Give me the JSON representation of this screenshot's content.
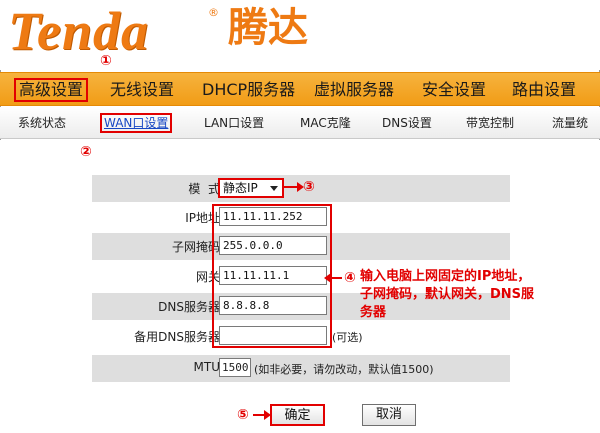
{
  "brand": {
    "logo_text": "Tenda",
    "reg_mark": "®",
    "logo_cn": "腾达"
  },
  "main_nav": [
    {
      "label": "高级设置",
      "active": true
    },
    {
      "label": "无线设置"
    },
    {
      "label": "DHCP服务器"
    },
    {
      "label": "虚拟服务器"
    },
    {
      "label": "安全设置"
    },
    {
      "label": "路由设置"
    }
  ],
  "sub_nav": [
    {
      "label": "系统状态"
    },
    {
      "label": "WAN口设置",
      "active": true
    },
    {
      "label": "LAN口设置"
    },
    {
      "label": "MAC克隆"
    },
    {
      "label": "DNS设置"
    },
    {
      "label": "带宽控制"
    },
    {
      "label": "流量统"
    }
  ],
  "form": {
    "mode_label": "模  式",
    "mode_value": "静态IP",
    "ip_label": "IP地址",
    "ip_value": "11.11.11.252",
    "mask_label": "子网掩码",
    "mask_value": "255.0.0.0",
    "gateway_label": "网关",
    "gateway_value": "11.11.11.1",
    "dns_label": "DNS服务器",
    "dns_value": "8.8.8.8",
    "dns2_label": "备用DNS服务器",
    "dns2_value": "",
    "dns2_hint": "(可选)",
    "mtu_label": "MTU",
    "mtu_value": "1500",
    "mtu_hint": "(如非必要，请勿改动，默认值1500)"
  },
  "buttons": {
    "ok": "确定",
    "cancel": "取消"
  },
  "annotations": {
    "m1": "①",
    "m2": "②",
    "m3": "③",
    "m4": "④",
    "m5": "⑤",
    "note": "输入电脑上网固定的IP地址，子网掩码，默认网关，DNS服务器"
  },
  "colors": {
    "accent": "#f19c16",
    "highlight": "#e20000",
    "brand": "#ee7a13"
  }
}
